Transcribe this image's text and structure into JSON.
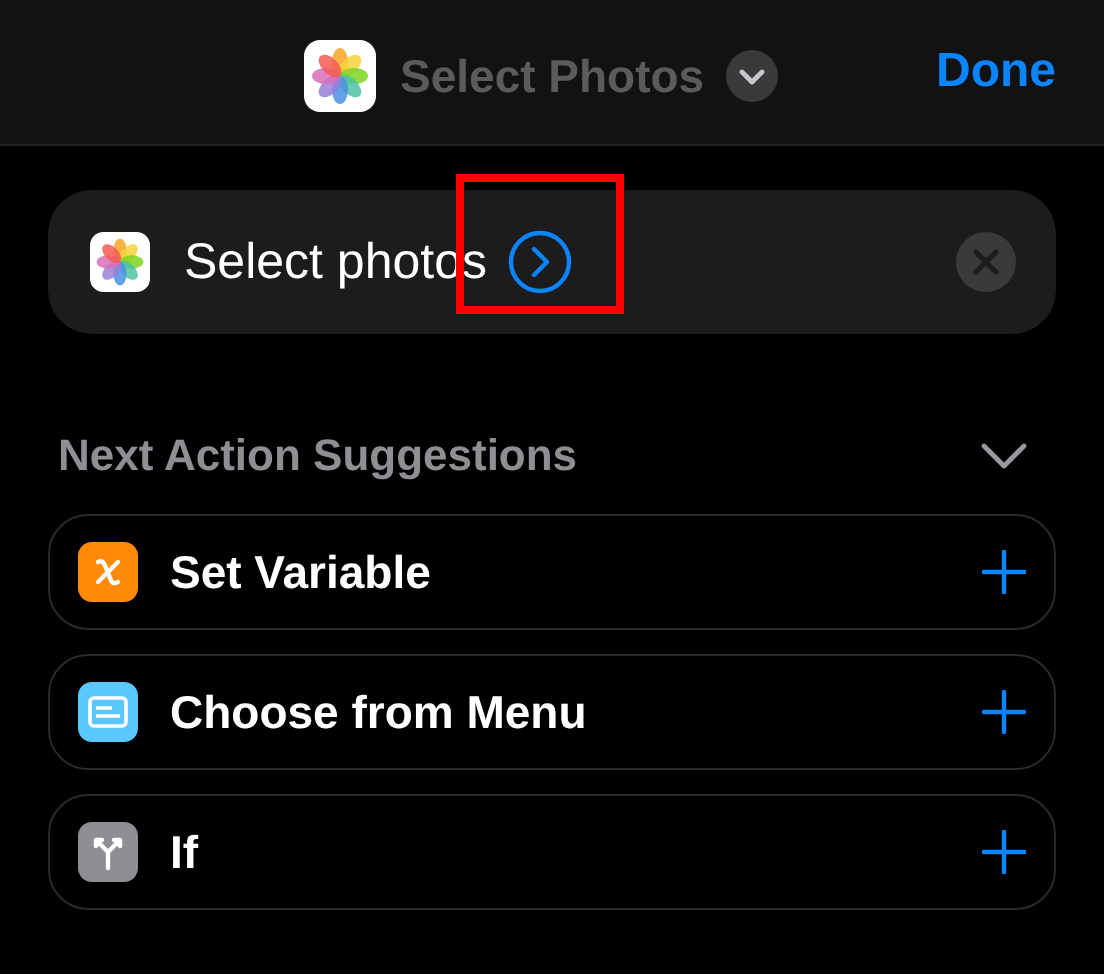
{
  "header": {
    "title": "Select Photos",
    "done": "Done"
  },
  "action": {
    "label": "Select photos",
    "highlighted": true
  },
  "suggestions": {
    "title": "Next Action Suggestions",
    "expanded": true,
    "items": [
      {
        "label": "Set Variable",
        "kind": "variable",
        "color": "#ff8a0a"
      },
      {
        "label": "Choose from Menu",
        "kind": "menu",
        "color": "#5ac8fa"
      },
      {
        "label": "If",
        "kind": "branch",
        "color": "#8e8e93"
      }
    ]
  }
}
